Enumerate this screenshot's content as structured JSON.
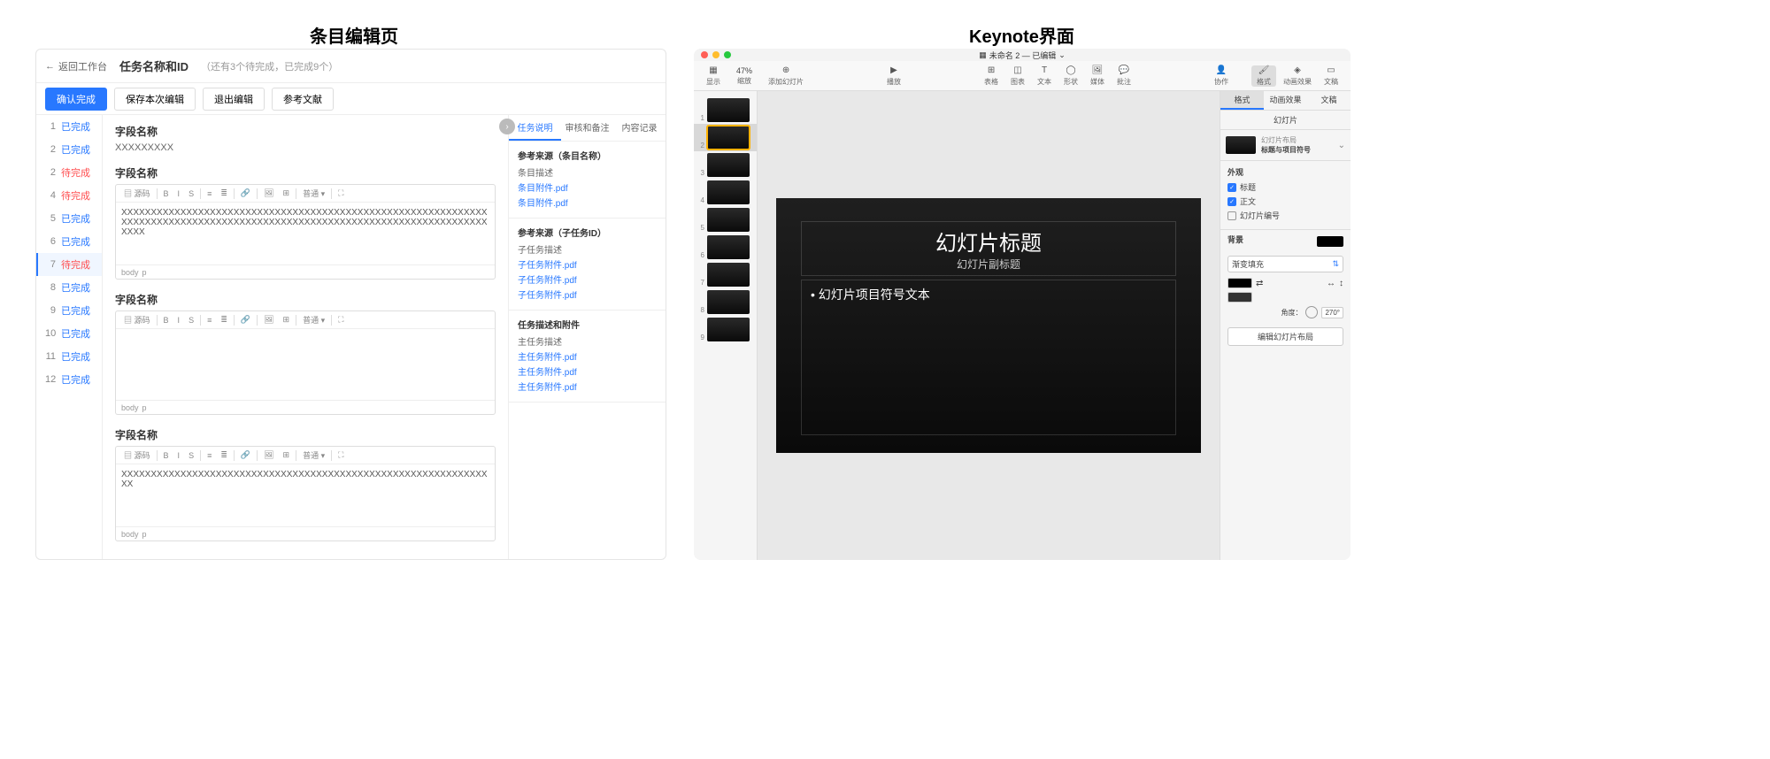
{
  "labels": {
    "left": "条目编辑页",
    "right": "Keynote界面"
  },
  "editor": {
    "back": "返回工作台",
    "title": "任务名称和ID",
    "subtitle": "（还有3个待完成，已完成9个）",
    "actions": {
      "confirm": "确认完成",
      "save": "保存本次编辑",
      "exit": "退出编辑",
      "refs": "参考文献"
    },
    "sidebar": [
      {
        "n": "1",
        "s": "已完成",
        "c": "done"
      },
      {
        "n": "2",
        "s": "已完成",
        "c": "done"
      },
      {
        "n": "2",
        "s": "待完成",
        "c": "pending"
      },
      {
        "n": "4",
        "s": "待完成",
        "c": "pending"
      },
      {
        "n": "5",
        "s": "已完成",
        "c": "done"
      },
      {
        "n": "6",
        "s": "已完成",
        "c": "done"
      },
      {
        "n": "7",
        "s": "待完成",
        "c": "pending",
        "active": true
      },
      {
        "n": "8",
        "s": "已完成",
        "c": "done"
      },
      {
        "n": "9",
        "s": "已完成",
        "c": "done"
      },
      {
        "n": "10",
        "s": "已完成",
        "c": "done"
      },
      {
        "n": "11",
        "s": "已完成",
        "c": "done"
      },
      {
        "n": "12",
        "s": "已完成",
        "c": "done"
      }
    ],
    "field_label": "字段名称",
    "field1_val": "XXXXXXXXX",
    "toolbar": {
      "src": "源码",
      "b": "B",
      "i": "I",
      "s": "S",
      "select": "普通"
    },
    "body_text_long": "XXXXXXXXXXXXXXXXXXXXXXXXXXXXXXXXXXXXXXXXXXXXXXXXXXXXXXXXXXXXXXXXXXXXXXXXXXXXXXXXXXXXXXXXXXXXXXXXXXXXXXXXXXXXXXXXXXXXXXXXXXXXXXXX",
    "body_text_short": "XXXXXXXXXXXXXXXXXXXXXXXXXXXXXXXXXXXXXXXXXXXXXXXXXXXXXXXXXXXXXXXX",
    "footer_body": "body",
    "footer_p": "p",
    "tabs": {
      "t1": "任务说明",
      "t2": "审核和备注",
      "t3": "内容记录"
    },
    "ref1": {
      "title": "参考来源（条目名称）",
      "desc": "条目描述",
      "links": [
        "条目附件.pdf",
        "条目附件.pdf"
      ]
    },
    "ref2": {
      "title": "参考来源（子任务ID）",
      "desc": "子任务描述",
      "links": [
        "子任务附件.pdf",
        "子任务附件.pdf",
        "子任务附件.pdf"
      ]
    },
    "ref3": {
      "title": "任务描述和附件",
      "desc": "主任务描述",
      "links": [
        "主任务附件.pdf",
        "主任务附件.pdf",
        "主任务附件.pdf"
      ]
    }
  },
  "keynote": {
    "doc_title": "未命名 2 — 已编辑",
    "toolbar": {
      "view": "显示",
      "zoom": "47%",
      "scale": "缩放",
      "add": "添加幻灯片",
      "play": "播放",
      "table": "表格",
      "chart": "图表",
      "text": "文本",
      "shape": "形状",
      "media": "媒体",
      "comment": "批注",
      "collab": "协作",
      "format": "格式",
      "anim": "动画效果",
      "doc": "文稿"
    },
    "thumbs": [
      1,
      2,
      3,
      4,
      5,
      6,
      7,
      8,
      9
    ],
    "selected_thumb": 2,
    "slide": {
      "title": "幻灯片标题",
      "subtitle": "幻灯片副标题",
      "bullet": "• 幻灯片项目符号文本"
    },
    "inspector": {
      "tabs": {
        "format": "格式",
        "anim": "动画效果",
        "doc": "文稿"
      },
      "sub": "幻灯片",
      "layout_label": "幻灯片布局",
      "layout_name": "标题与项目符号",
      "appearance": "外观",
      "chk_title": "标题",
      "chk_body": "正文",
      "chk_num": "幻灯片编号",
      "background": "背景",
      "fill_type": "渐变填充",
      "angle_label": "角度：",
      "angle_val": "270°",
      "edit_layout": "编辑幻灯片布局"
    }
  }
}
